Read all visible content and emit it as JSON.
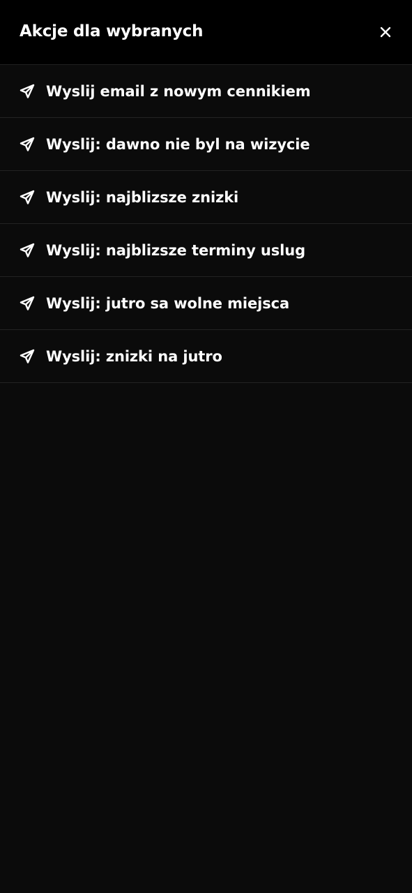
{
  "header": {
    "title": "Akcje dla wybranych",
    "close_icon": "close-icon"
  },
  "actions": [
    {
      "label": "Wyslij email z nowym cennikiem",
      "icon": "send-icon"
    },
    {
      "label": "Wyslij: dawno nie byl na wizycie",
      "icon": "send-icon"
    },
    {
      "label": "Wyslij: najblizsze znizki",
      "icon": "send-icon"
    },
    {
      "label": "Wyslij: najblizsze terminy uslug",
      "icon": "send-icon"
    },
    {
      "label": "Wyslij: jutro sa wolne miejsca",
      "icon": "send-icon"
    },
    {
      "label": "Wyslij: znizki na jutro",
      "icon": "send-icon"
    }
  ],
  "colors": {
    "header_bg": "#000000",
    "panel_bg": "#0b0b0b",
    "divider": "#232323",
    "text": "#ffffff"
  }
}
